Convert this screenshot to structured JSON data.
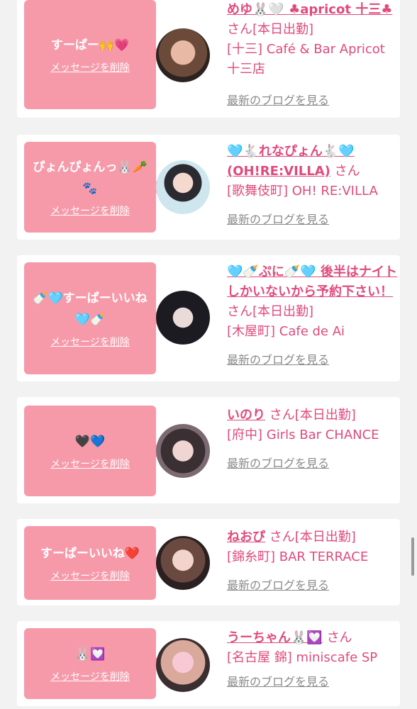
{
  "entries": [
    {
      "message": "すーぱー🙌💗",
      "delete_label": "メッセージを削除",
      "name": "めゆ🐰🤍 ♣apricot 十三♣",
      "suffix": "さん[本日出勤]",
      "store": "[十三] Café & Bar Apricot 十三店",
      "blog": "最新のブログを見る"
    },
    {
      "message": "ぴょんぴょんっ🐰🥕🐾",
      "delete_label": "メッセージを削除",
      "name": "🩵🐇れなぴょん🐇🩵 (OH!RE:VILLA)",
      "suffix": "さん",
      "store": "[歌舞伎町] OH! RE:VILLA",
      "blog": "最新のブログを見る"
    },
    {
      "message": "🍼🩵すーぱーいいね🩵🍼",
      "delete_label": "メッセージを削除",
      "name": "🩵🍼ぷに🍼🩵 後半はナイトしかいないから予約下さい！",
      "suffix": "さん[本日出勤]",
      "store": "[木屋町] Cafe de Ai",
      "blog": "最新のブログを見る"
    },
    {
      "message": "🖤💙",
      "delete_label": "メッセージを削除",
      "name": "いのり",
      "suffix": "さん[本日出勤]",
      "store": "[府中] Girls Bar CHANCE",
      "blog": "最新のブログを見る"
    },
    {
      "message": "すーぱーいいね❤️",
      "delete_label": "メッセージを削除",
      "name": "ねおぴ",
      "suffix": "さん[本日出勤]",
      "store": "[錦糸町] BAR TERRACE",
      "blog": "最新のブログを見る"
    },
    {
      "message": "🐰💟",
      "delete_label": "メッセージを削除",
      "name": "うーちゃん🐰💟",
      "suffix": "さん",
      "store": "[名古屋 錦] miniscafe SP",
      "blog": "最新のブログを見る"
    }
  ],
  "colors": {
    "bubble": "#f69aaa",
    "accent_text": "#e04a7d",
    "muted_text": "#8a8a8a",
    "background": "#f2f2f2"
  }
}
